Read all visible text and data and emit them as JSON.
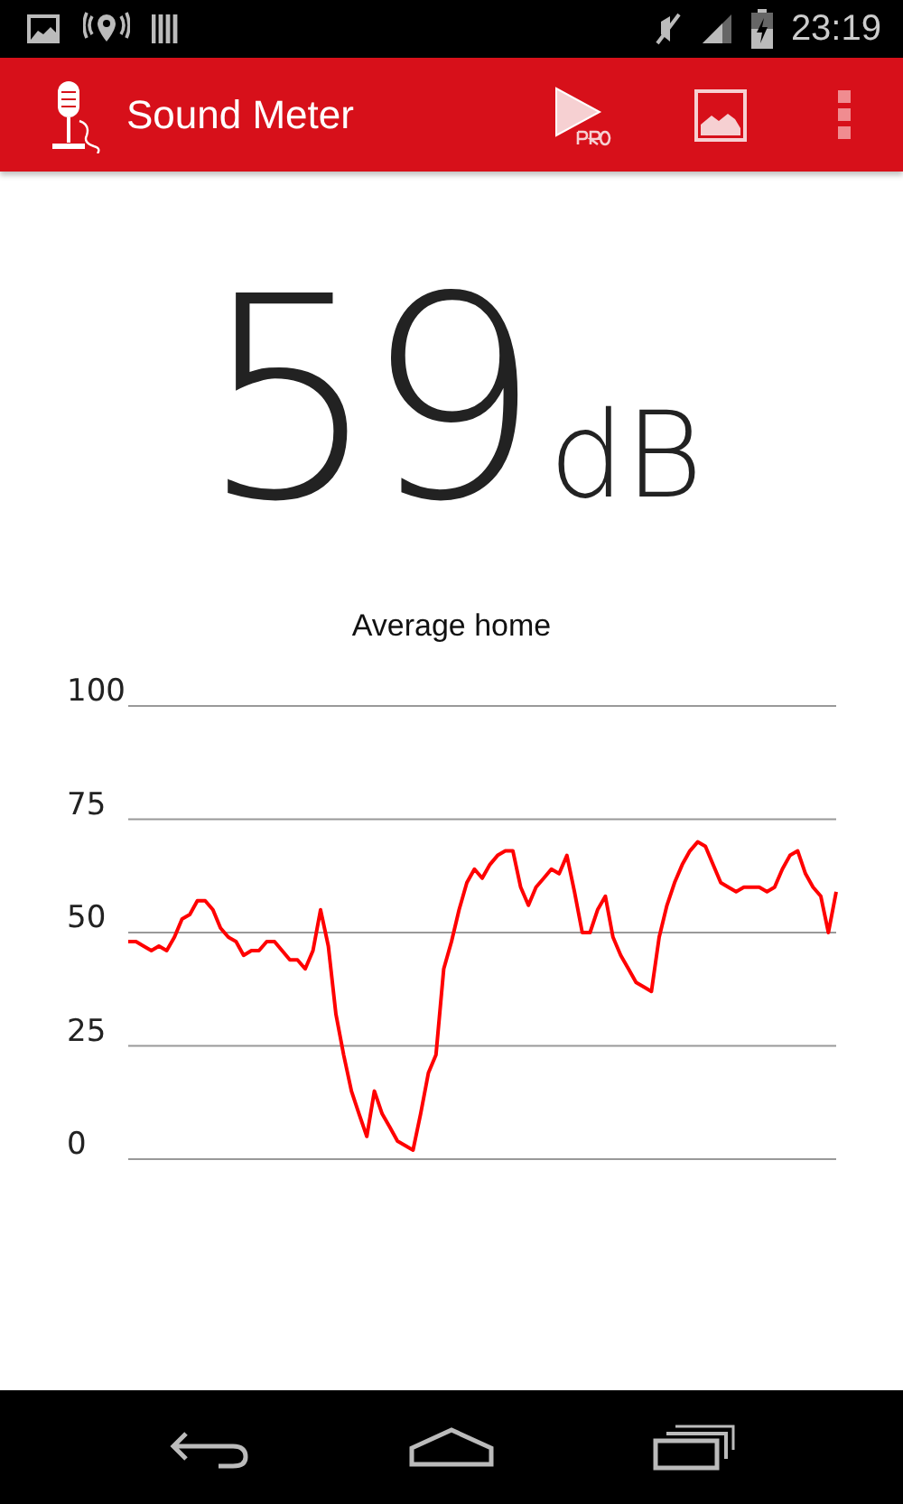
{
  "status_bar": {
    "time": "23:19"
  },
  "app_bar": {
    "title": "Sound Meter"
  },
  "reading": {
    "value": "59",
    "unit": "dB"
  },
  "chart": {
    "chart_data": {
      "type": "line",
      "title": "Average home",
      "yticks": [
        0,
        25,
        50,
        75,
        100
      ],
      "ylim": [
        0,
        100
      ],
      "grid": true,
      "series": [
        {
          "color": "#ff0000",
          "values": [
            48,
            48,
            47,
            46,
            47,
            46,
            49,
            53,
            54,
            57,
            57,
            55,
            51,
            49,
            48,
            45,
            46,
            46,
            48,
            48,
            46,
            44,
            44,
            42,
            46,
            55,
            47,
            32,
            23,
            15,
            10,
            5,
            15,
            10,
            7,
            4,
            3,
            2,
            10,
            19,
            23,
            42,
            48,
            55,
            61,
            64,
            62,
            65,
            67,
            68,
            68,
            60,
            56,
            60,
            62,
            64,
            63,
            67,
            59,
            50,
            50,
            55,
            58,
            49,
            45,
            42,
            39,
            38,
            37,
            49,
            56,
            61,
            65,
            68,
            70,
            69,
            65,
            61,
            60,
            59,
            60,
            60,
            60,
            59,
            60,
            64,
            67,
            68,
            63,
            60,
            58,
            50,
            59
          ]
        }
      ]
    }
  }
}
